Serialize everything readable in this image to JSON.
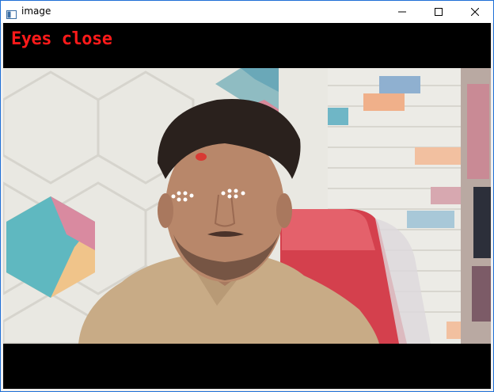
{
  "window": {
    "title": "image"
  },
  "overlay": {
    "status_text": "Eyes close",
    "status_color": "#ff1a1a"
  },
  "icons": {
    "app": "app-window-icon",
    "minimize": "minimize-icon",
    "maximize": "maximize-icon",
    "close": "close-icon"
  },
  "landmarks": {
    "color": "#ffffff",
    "left_eye_points": 6,
    "right_eye_points": 6
  }
}
